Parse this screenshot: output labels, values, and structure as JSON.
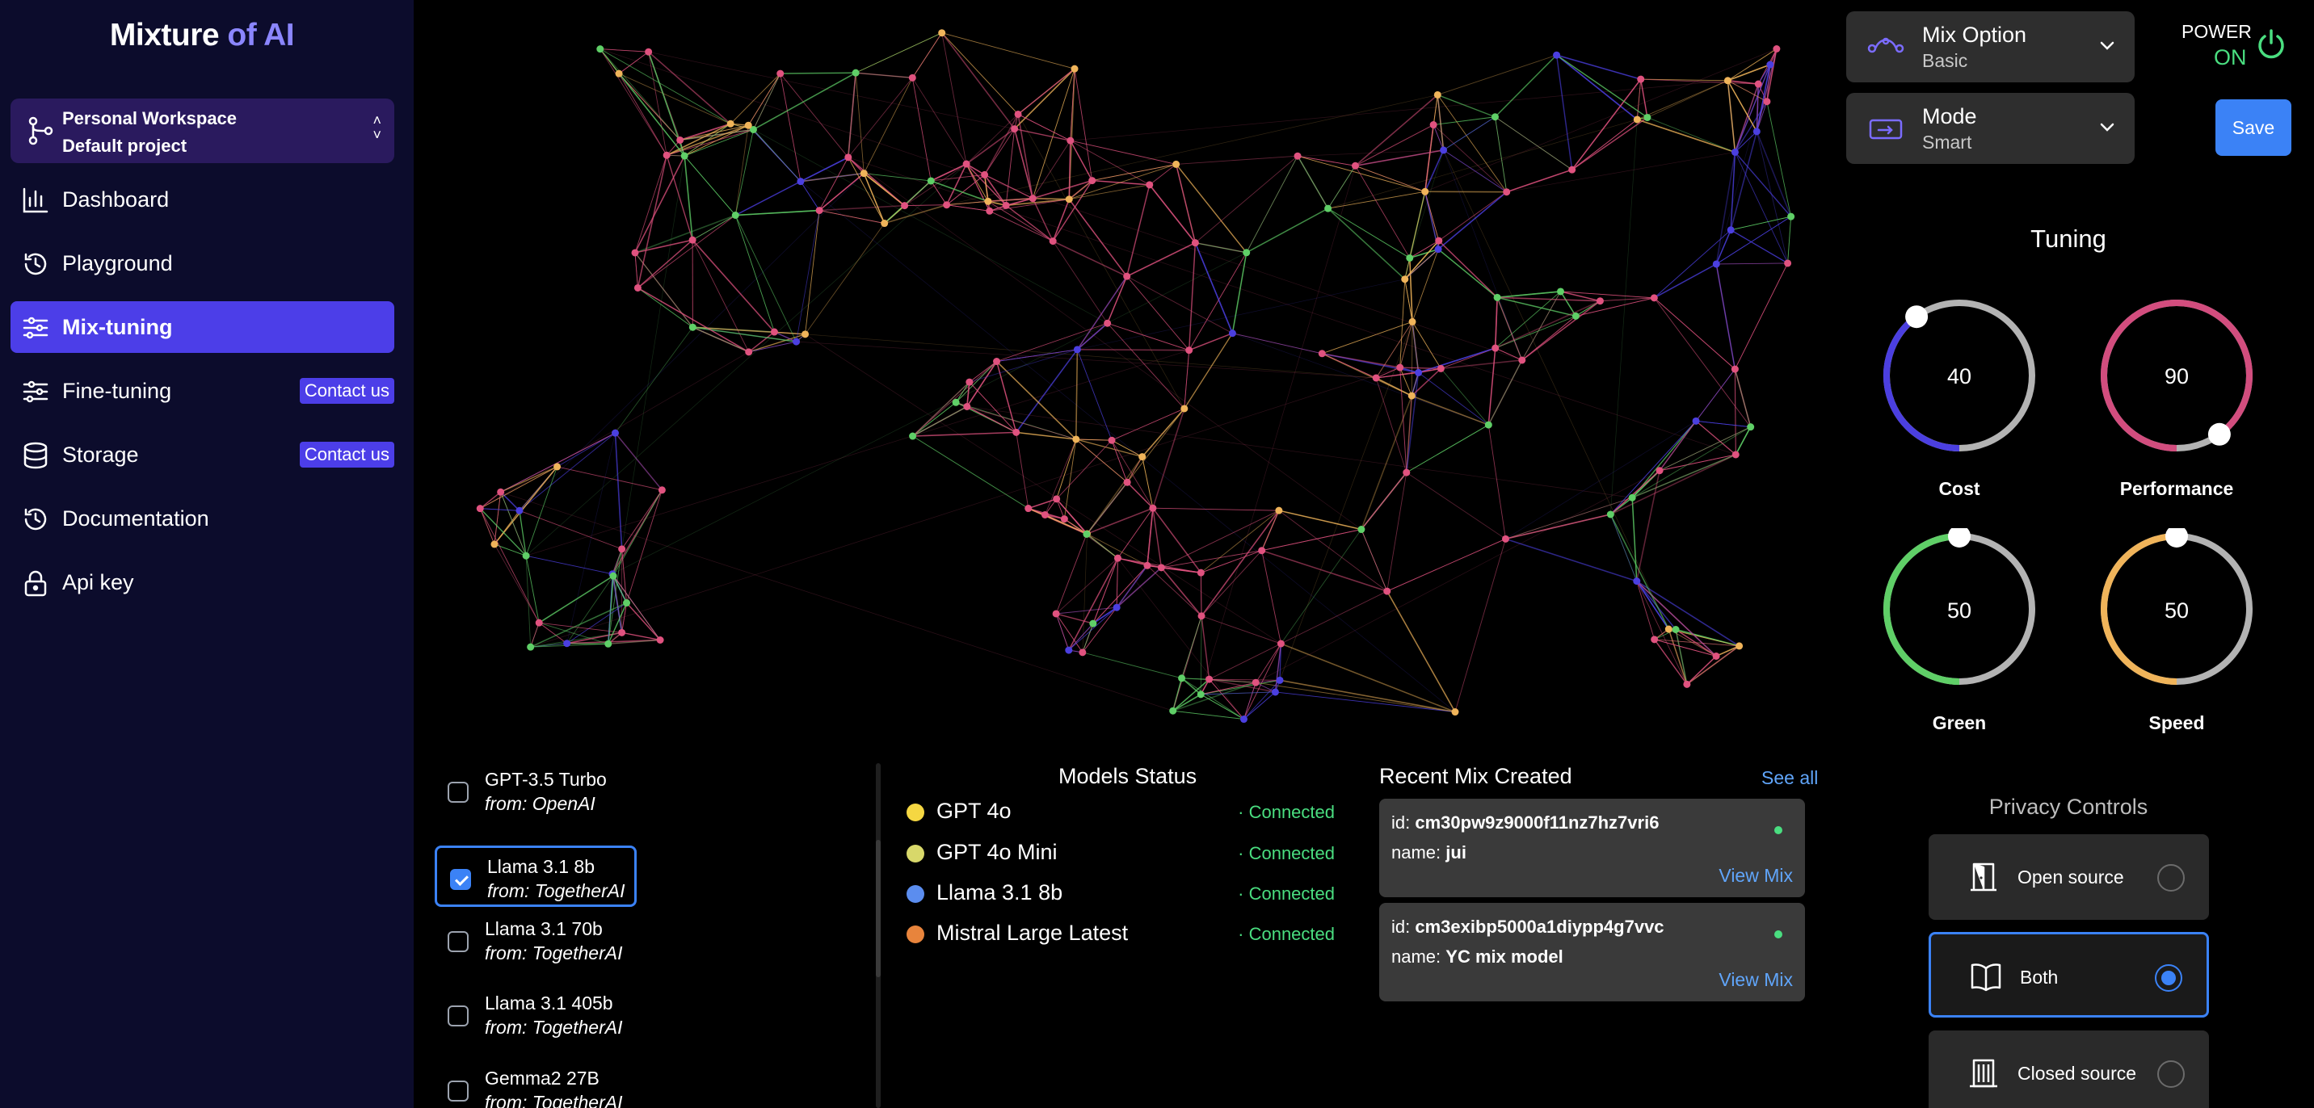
{
  "brand": {
    "part1": "Mixture",
    "part2": " of AI"
  },
  "workspace": {
    "title": "Personal Workspace",
    "subtitle": "Default project"
  },
  "sidebar": {
    "items": [
      {
        "label": "Dashboard",
        "icon": "bar-chart-icon"
      },
      {
        "label": "Playground",
        "icon": "history-icon"
      },
      {
        "label": "Mix-tuning",
        "icon": "sliders-icon",
        "active": true
      },
      {
        "label": "Fine-tuning",
        "icon": "sliders-icon",
        "badge": "Contact us"
      },
      {
        "label": "Storage",
        "icon": "database-icon",
        "badge": "Contact us"
      },
      {
        "label": "Documentation",
        "icon": "history-icon"
      },
      {
        "label": "Api key",
        "icon": "lock-icon"
      }
    ]
  },
  "models_list": [
    {
      "name": "GPT-3.5 Turbo",
      "from": "from: OpenAI",
      "selected": false
    },
    {
      "name": "Llama 3.1 8b",
      "from": "from: TogetherAI",
      "selected": true
    },
    {
      "name": "Llama 3.1 70b",
      "from": "from: TogetherAI",
      "selected": false
    },
    {
      "name": "Llama 3.1 405b",
      "from": "from: TogetherAI",
      "selected": false
    },
    {
      "name": "Gemma2 27B",
      "from": "from: TogetherAI",
      "selected": false
    }
  ],
  "models_status": {
    "title": "Models Status",
    "items": [
      {
        "name": "GPT 4o",
        "status": "· Connected",
        "color": "#f5d742"
      },
      {
        "name": "GPT 4o Mini",
        "status": "· Connected",
        "color": "#d8d86a"
      },
      {
        "name": "Llama 3.1 8b",
        "status": "· Connected",
        "color": "#5b8def"
      },
      {
        "name": "Mistral Large Latest",
        "status": "· Connected",
        "color": "#e8843c"
      }
    ]
  },
  "recent_mix": {
    "title": "Recent Mix Created",
    "see_all": "See all",
    "items": [
      {
        "id_label": "id: ",
        "id": "cm30pw9z9000f11nz7hz7vri6",
        "name_label": "name: ",
        "name": "jui",
        "view": "View Mix"
      },
      {
        "id_label": "id: ",
        "id": "cm3exibp5000a1diypp4g7vvc",
        "name_label": "name: ",
        "name": "YC mix model",
        "view": "View Mix"
      }
    ]
  },
  "mix_option": {
    "title": "Mix Option",
    "value": "Basic"
  },
  "mode": {
    "title": "Mode",
    "value": "Smart"
  },
  "power": {
    "label": "POWER",
    "state": "ON"
  },
  "save_label": "Save",
  "tuning": {
    "title": "Tuning",
    "knobs": [
      {
        "label": "Cost",
        "value": "40",
        "level": 0.4,
        "color": "#4b3fe0"
      },
      {
        "label": "Performance",
        "value": "90",
        "level": 0.9,
        "color": "#d24d7e"
      },
      {
        "label": "Green",
        "value": "50",
        "level": 0.5,
        "color": "#5fcf67"
      },
      {
        "label": "Speed",
        "value": "50",
        "level": 0.5,
        "color": "#f0b45a"
      }
    ]
  },
  "privacy": {
    "title": "Privacy Controls",
    "options": [
      {
        "label": "Open source",
        "icon": "door-open-icon",
        "selected": false
      },
      {
        "label": "Both",
        "icon": "book-open-icon",
        "selected": true
      },
      {
        "label": "Closed source",
        "icon": "door-closed-icon",
        "selected": false
      }
    ]
  },
  "colors": {
    "accent": "#4c3ee8",
    "link": "#60a5fa",
    "connected": "#4ade80"
  }
}
